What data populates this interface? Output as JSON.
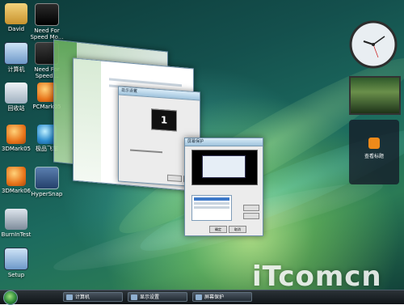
{
  "desktop": {
    "icons": [
      {
        "label": "David"
      },
      {
        "label": "Need For Speed Mo..."
      },
      {
        "label": "计算机"
      },
      {
        "label": "Need For Speed..."
      },
      {
        "label": "回收站"
      },
      {
        "label": "PCMark05"
      },
      {
        "label": "3DMark05"
      },
      {
        "label": "极品飞车"
      },
      {
        "label": "3DMark06"
      },
      {
        "label": "HyperSnap"
      },
      {
        "label": "BurnInTest"
      },
      {
        "label": "Setup"
      }
    ]
  },
  "windows": {
    "display_settings_title": "显示设置",
    "monitor_number": "1",
    "dialog_title": "屏幕保护",
    "dialog_ok": "确定",
    "dialog_cancel": "取消"
  },
  "gadgets": {
    "feed_label": "查看标题"
  },
  "taskbar": {
    "buttons": [
      {
        "label": "计算机"
      },
      {
        "label": "显示设置"
      },
      {
        "label": "屏幕保护"
      }
    ]
  },
  "watermark": "iTcomcn"
}
